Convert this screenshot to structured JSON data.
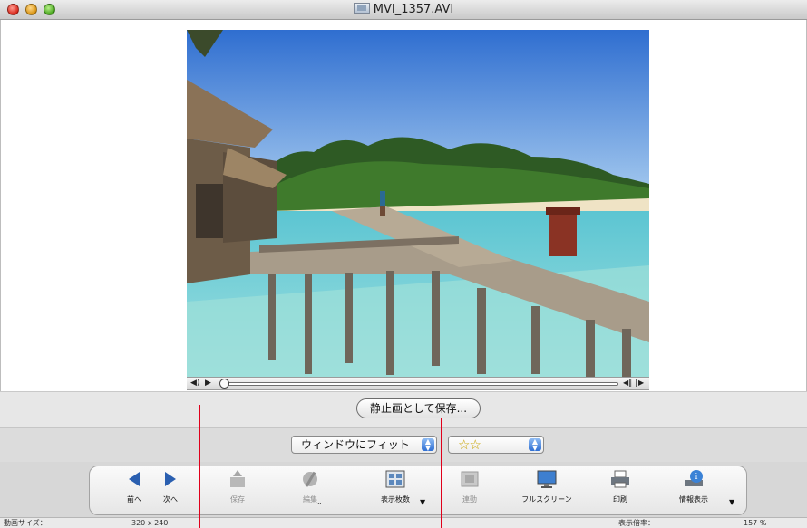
{
  "window": {
    "title": "MVI_1357.AVI"
  },
  "actions": {
    "save_still": "静止画として保存..."
  },
  "view": {
    "zoom_popup": "ウィンドウにフィット",
    "rating_popup": "☆☆"
  },
  "toolbar": {
    "prev": "前へ",
    "next": "次へ",
    "save": "保存",
    "edit": "編集",
    "display_count": "表示枚数",
    "linked": "連動",
    "fullscreen": "フルスクリーン",
    "print": "印刷",
    "info": "情報表示"
  },
  "status": {
    "size_label": "動画サイズ：",
    "size_value": "320 x 240",
    "zoom_label": "表示倍率：",
    "zoom_value": "157 %"
  },
  "colors": {
    "sky": "#3f7fd6",
    "sea": "#7fd2d8",
    "marker": "#e0001b"
  }
}
